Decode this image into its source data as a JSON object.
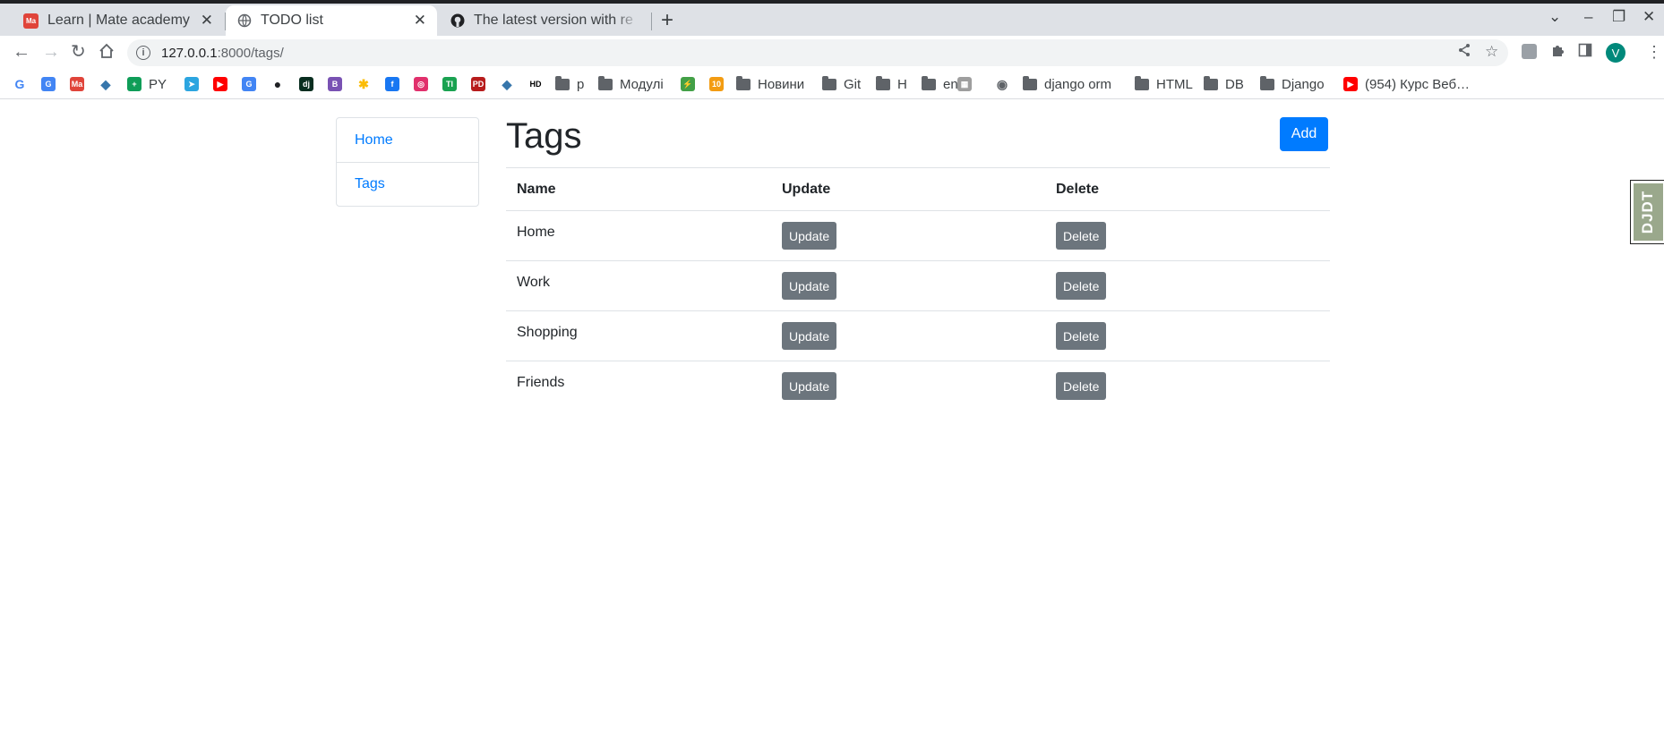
{
  "browser": {
    "tabs": [
      {
        "label": "Learn | Mate academy",
        "favicon_text": "Ma",
        "favicon_color": "#e0443a",
        "active": false
      },
      {
        "label": "TODO list",
        "favicon_text": "",
        "favicon_color": "#5f6368",
        "active": true
      },
      {
        "label": "The latest version with re",
        "favicon_text": "",
        "favicon_color": "#202124",
        "active": false
      }
    ],
    "close_glyph": "✕",
    "new_tab_glyph": "+",
    "url_host": "127.0.0.1",
    "url_rest": ":8000/tags/",
    "profile_initial": "V"
  },
  "bookmarks": [
    {
      "label": "",
      "icon": "google-icon"
    },
    {
      "label": "",
      "icon": "translate-icon"
    },
    {
      "label": "",
      "icon": "mate-icon"
    },
    {
      "label": "",
      "icon": "python-icon"
    },
    {
      "label": "PY",
      "icon": "sheets-icon"
    },
    {
      "label": "",
      "icon": "telegram-icon"
    },
    {
      "label": "",
      "icon": "youtube-icon"
    },
    {
      "label": "",
      "icon": "translate-icon"
    },
    {
      "label": "",
      "icon": "github-icon"
    },
    {
      "label": "",
      "icon": "django-icon"
    },
    {
      "label": "",
      "icon": "bootstrap-icon"
    },
    {
      "label": "",
      "icon": "photos-icon"
    },
    {
      "label": "",
      "icon": "facebook-icon"
    },
    {
      "label": "",
      "icon": "instagram-icon"
    },
    {
      "label": "",
      "icon": "tl-icon"
    },
    {
      "label": "",
      "icon": "pd-icon"
    },
    {
      "label": "",
      "icon": "python-icon"
    },
    {
      "label": "",
      "icon": "hd-icon"
    },
    {
      "label": "p",
      "icon": "folder-icon"
    },
    {
      "label": "Модулі",
      "icon": "folder-icon"
    },
    {
      "label": "",
      "icon": "bolt-icon"
    },
    {
      "label": "",
      "icon": "calendar-icon"
    },
    {
      "label": "Новини",
      "icon": "folder-icon"
    },
    {
      "label": "Git",
      "icon": "folder-icon"
    },
    {
      "label": "H",
      "icon": "folder-icon"
    },
    {
      "label": "en",
      "icon": "folder-icon"
    },
    {
      "label": "",
      "icon": "image-icon"
    },
    {
      "label": "",
      "icon": "globe-icon"
    },
    {
      "label": "django orm",
      "icon": "folder-icon"
    },
    {
      "label": "HTML",
      "icon": "folder-icon"
    },
    {
      "label": "DB",
      "icon": "folder-icon"
    },
    {
      "label": "Django",
      "icon": "folder-icon"
    },
    {
      "label": "(954) Курс Веб…",
      "icon": "youtube-icon"
    }
  ],
  "sidebar": {
    "items": [
      {
        "label": "Home"
      },
      {
        "label": "Tags"
      }
    ]
  },
  "main": {
    "title": "Tags",
    "add_label": "Add",
    "columns": [
      "Name",
      "Update",
      "Delete"
    ],
    "rows": [
      {
        "name": "Home",
        "update": "Update",
        "delete": "Delete"
      },
      {
        "name": "Work",
        "update": "Update",
        "delete": "Delete"
      },
      {
        "name": "Shopping",
        "update": "Update",
        "delete": "Delete"
      },
      {
        "name": "Friends",
        "update": "Update",
        "delete": "Delete"
      }
    ]
  },
  "debug_toolbar": {
    "label": "DJDT"
  },
  "colors": {
    "primary": "#007bff",
    "secondary": "#6c757d",
    "djdt": "#9aa88c"
  }
}
